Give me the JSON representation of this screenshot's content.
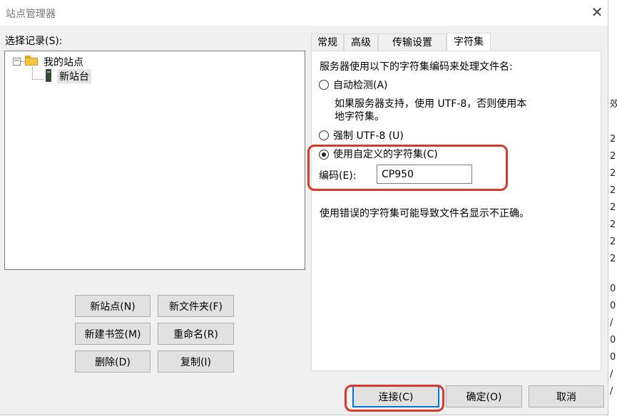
{
  "window": {
    "title": "站点管理器",
    "close_glyph": "✕"
  },
  "left": {
    "select_label": "选择记录(S):",
    "tree": [
      {
        "label": "我的站点",
        "expander": "−"
      },
      {
        "label": "新站台"
      }
    ],
    "buttons": {
      "new_site": "新站点(N)",
      "new_folder": "新文件夹(F)",
      "new_bookmark": "新建书签(M)",
      "rename": "重命名(R)",
      "delete": "删除(D)",
      "copy": "复制(I)"
    }
  },
  "tabs": [
    {
      "label": "常规"
    },
    {
      "label": "高级"
    },
    {
      "label": "传输设置"
    },
    {
      "label": "字符集",
      "active": true
    }
  ],
  "charset": {
    "intro": "服务器使用以下的字符集编码来处理文件名:",
    "auto_detect": "自动检测(A)",
    "auto_desc_line1": "如果服务器支持，使用 UTF-8，否则使用本",
    "auto_desc_line2": "地字符集。",
    "force_utf8": "强制 UTF-8 (U)",
    "custom": "使用自定义的字符集(C)",
    "encoding_label": "编码(E):",
    "encoding_value": "CP950",
    "selected": "custom",
    "warning": "使用错误的字符集可能导致文件名显示不正确。"
  },
  "footer": {
    "connect": "连接(C)",
    "ok": "确定(O)",
    "cancel": "取消"
  },
  "background": {
    "right_column": [
      "效",
      "2",
      "2",
      "2",
      "2",
      "2",
      "2",
      "2",
      "2",
      "0",
      "0",
      "/",
      "0",
      "0",
      "/",
      "/"
    ]
  },
  "colors": {
    "highlight": "#d9382b",
    "accent": "#0078d7"
  }
}
